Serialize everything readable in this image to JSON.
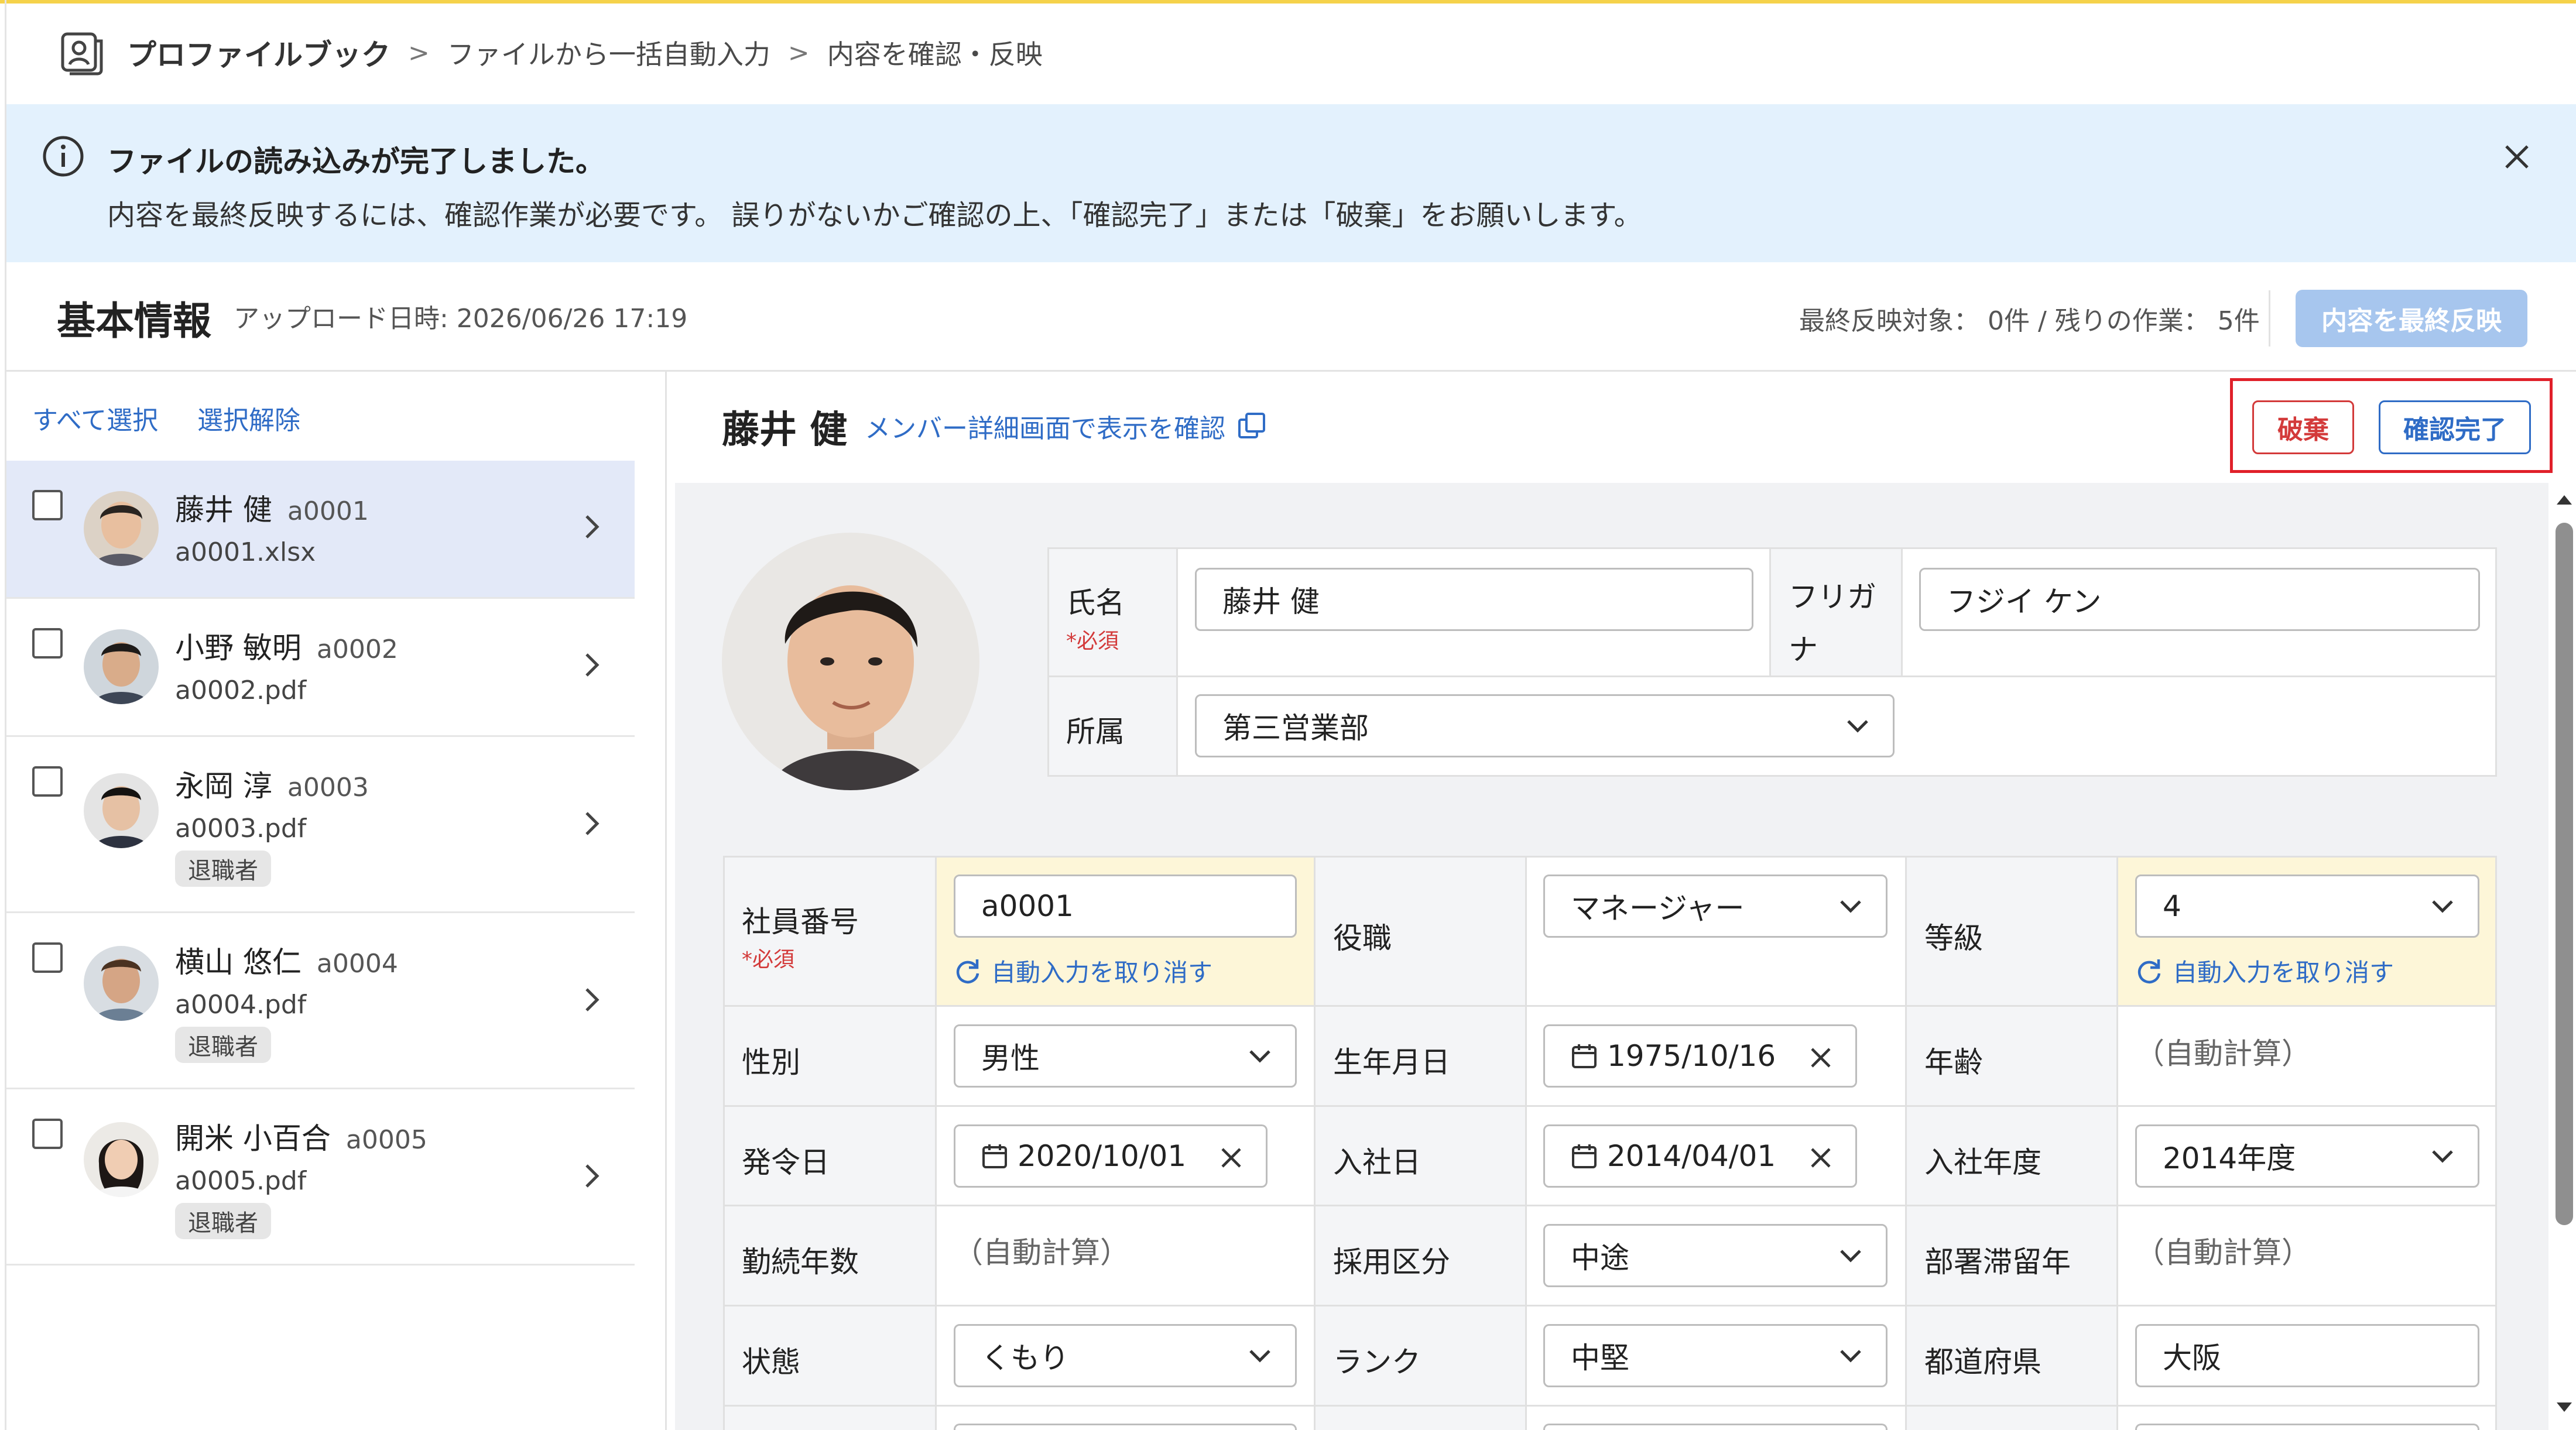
{
  "breadcrumb": {
    "root": "プロファイルブック",
    "step2": "ファイルから一括自動入力",
    "step3": "内容を確認・反映"
  },
  "banner": {
    "title": "ファイルの読み込みが完了しました。",
    "message": "内容を最終反映するには、確認作業が必要です。 誤りがないかご確認の上、「確認完了」または「破棄」をお願いします。"
  },
  "header": {
    "title": "基本情報",
    "upload_datetime": "アップロード日時: 2026/06/26 17:19",
    "progress": "最終反映対象： 0件 / 残りの作業： 5件",
    "final_button": "内容を最終反映"
  },
  "list": {
    "select_all": "すべて選択",
    "deselect": "選択解除",
    "items": [
      {
        "name": "藤井 健",
        "code": "a0001",
        "file": "a0001.xlsx",
        "badge": ""
      },
      {
        "name": "小野 敏明",
        "code": "a0002",
        "file": "a0002.pdf",
        "badge": ""
      },
      {
        "name": "永岡 淳",
        "code": "a0003",
        "file": "a0003.pdf",
        "badge": "退職者"
      },
      {
        "name": "横山 悠仁",
        "code": "a0004",
        "file": "a0004.pdf",
        "badge": "退職者"
      },
      {
        "name": "開米 小百合",
        "code": "a0005",
        "file": "a0005.pdf",
        "badge": "退職者"
      }
    ]
  },
  "detail": {
    "person_name": "藤井 健",
    "view_link": "メンバー詳細画面で表示を確認",
    "discard_label": "破棄",
    "confirm_label": "確認完了"
  },
  "form": {
    "required_mark": "*必須",
    "auto_calc": "（自動計算）",
    "revert_label": "自動入力を取り消す",
    "name_label": "氏名",
    "name_value": "藤井 健",
    "kana_label": "フリガナ",
    "kana_label_line1": "フリガ",
    "kana_label_line2": "ナ",
    "kana_value": "フジイ ケン",
    "dept_label": "所属",
    "dept_value": "第三営業部",
    "emp_no_label": "社員番号",
    "emp_no_value": "a0001",
    "position_label": "役職",
    "position_value": "マネージャー",
    "grade_label": "等級",
    "grade_value": "4",
    "gender_label": "性別",
    "gender_value": "男性",
    "birth_label": "生年月日",
    "birth_value": "1975/10/16",
    "age_label": "年齢",
    "issue_label": "発令日",
    "issue_value": "2020/10/01",
    "join_label": "入社日",
    "join_value": "2014/04/01",
    "join_year_label": "入社年度",
    "join_year_value": "2014年度",
    "tenure_label": "勤続年数",
    "hire_type_label": "採用区分",
    "hire_type_value": "中途",
    "dept_years_label": "部署滞留年",
    "status_label": "状態",
    "status_value": "くもり",
    "rank_label": "ランク",
    "rank_value": "中堅",
    "pref_label": "都道府県",
    "pref_value": "大阪"
  },
  "colors": {
    "accent": "#2f6cc6",
    "danger": "#d33a3a",
    "banner_bg": "#e3f1fd",
    "highlight": "#fdf6d8",
    "selected_row": "#e3e9f8"
  }
}
